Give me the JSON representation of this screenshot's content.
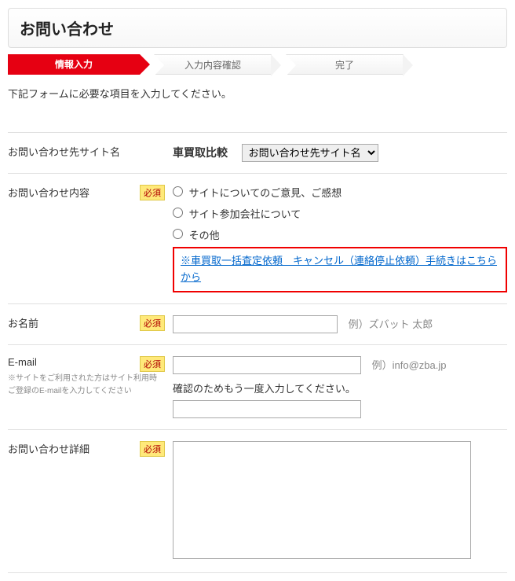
{
  "page_title": "お問い合わせ",
  "steps": {
    "step1": "情報入力",
    "step2": "入力内容確認",
    "step3": "完了"
  },
  "intro": "下記フォームに必要な項目を入力してください。",
  "required_label": "必須",
  "rows": {
    "site": {
      "label": "お問い合わせ先サイト名",
      "site_name": "車買取比較",
      "select_placeholder": "お問い合わせ先サイト名"
    },
    "inquiry_type": {
      "label": "お問い合わせ内容",
      "options": {
        "opt1": "サイトについてのご意見、ご感想",
        "opt2": "サイト参加会社について",
        "opt3": "その他"
      },
      "link_text": "※車買取一括査定依頼　キャンセル（連絡停止依頼）手続きはこちらから"
    },
    "name": {
      "label": "お名前",
      "example": "例）ズバット 太郎"
    },
    "email": {
      "label": "E-mail",
      "note1": "※サイトをご利用された方はサイト利用時",
      "note2": "ご登録のE-mailを入力してください",
      "example": "例）info@zba.jp",
      "confirm_note": "確認のためもう一度入力してください。"
    },
    "detail": {
      "label": "お問い合わせ詳細"
    }
  }
}
